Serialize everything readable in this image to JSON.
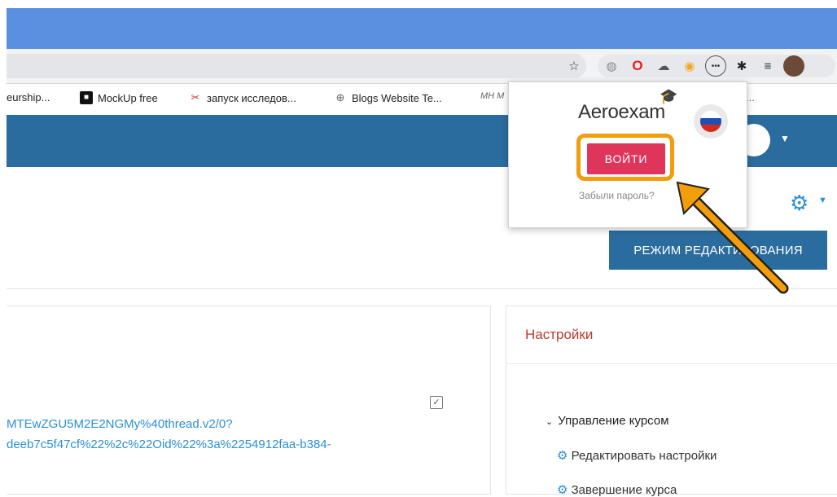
{
  "browser": {
    "bookmarks": [
      {
        "label": "eurship...",
        "icon": "bookmark-icon"
      },
      {
        "label": "MockUp free",
        "icon": "mockup-icon"
      },
      {
        "label": "запуск исследов...",
        "icon": "tool-icon"
      },
      {
        "label": "Blogs Website Te...",
        "icon": "link-icon"
      },
      {
        "label": "MH M",
        "icon": "mh-icon"
      },
      {
        "label": "...",
        "icon": ""
      }
    ],
    "toolbar_icons": [
      "star-icon",
      "globe-icon",
      "opera-icon",
      "cloud-icon",
      "chrome-icon",
      "password-icon",
      "puzzle-icon",
      "playlist-icon",
      "profile-icon"
    ]
  },
  "site": {
    "edit_mode_label": "РЕЖИМ РЕДАКТИРОВАНИЯ",
    "link_line_1": "MTEwZGU5M2E2NGMy%40thread.v2/0?",
    "link_line_2": "deeb7c5f47cf%22%2c%22Oid%22%3a%2254912faa-b384-",
    "settings": {
      "title": "Настройки",
      "course_mgmt": "Управление курсом",
      "edit_settings": "Редактировать настройки",
      "next_item": "Завершение курса"
    }
  },
  "popup": {
    "logo": "Aeroexam",
    "login_label": "ВОЙТИ",
    "forgot_label": "Забыли пароль?"
  },
  "colors": {
    "title_bar": "#5b8fdf",
    "navbar": "#2b6c9e",
    "login_button": "#e0355a",
    "highlight": "#f29d0c",
    "link": "#2b8fd6",
    "settings_title": "#c0392b"
  }
}
